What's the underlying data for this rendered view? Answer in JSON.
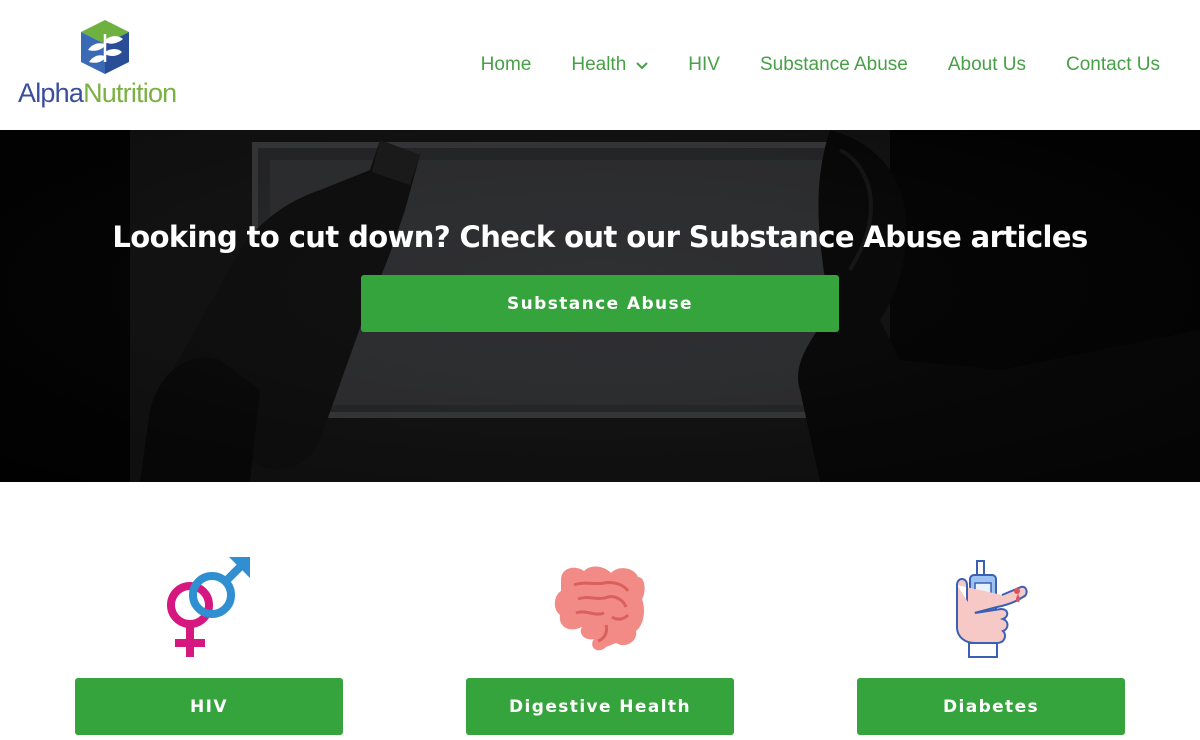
{
  "brand": {
    "logo_alpha": "Alpha",
    "logo_nutrition": "Nutrition"
  },
  "nav": {
    "items": [
      {
        "label": "Home"
      },
      {
        "label": "Health",
        "has_dropdown": true
      },
      {
        "label": "HIV"
      },
      {
        "label": "Substance Abuse"
      },
      {
        "label": "About Us"
      },
      {
        "label": "Contact Us"
      }
    ]
  },
  "hero": {
    "title": "Looking to cut down? Check out our Substance Abuse articles",
    "button_label": "Substance Abuse"
  },
  "categories": [
    {
      "label": "HIV",
      "icon": "gender-symbols-icon"
    },
    {
      "label": "Digestive Health",
      "icon": "intestines-icon"
    },
    {
      "label": "Diabetes",
      "icon": "glucose-meter-hand-icon"
    }
  ],
  "colors": {
    "brand_green": "#35a43d",
    "nav_green": "#47a046",
    "logo_blue": "#3a4f9c",
    "logo_light_green": "#7bb142"
  }
}
